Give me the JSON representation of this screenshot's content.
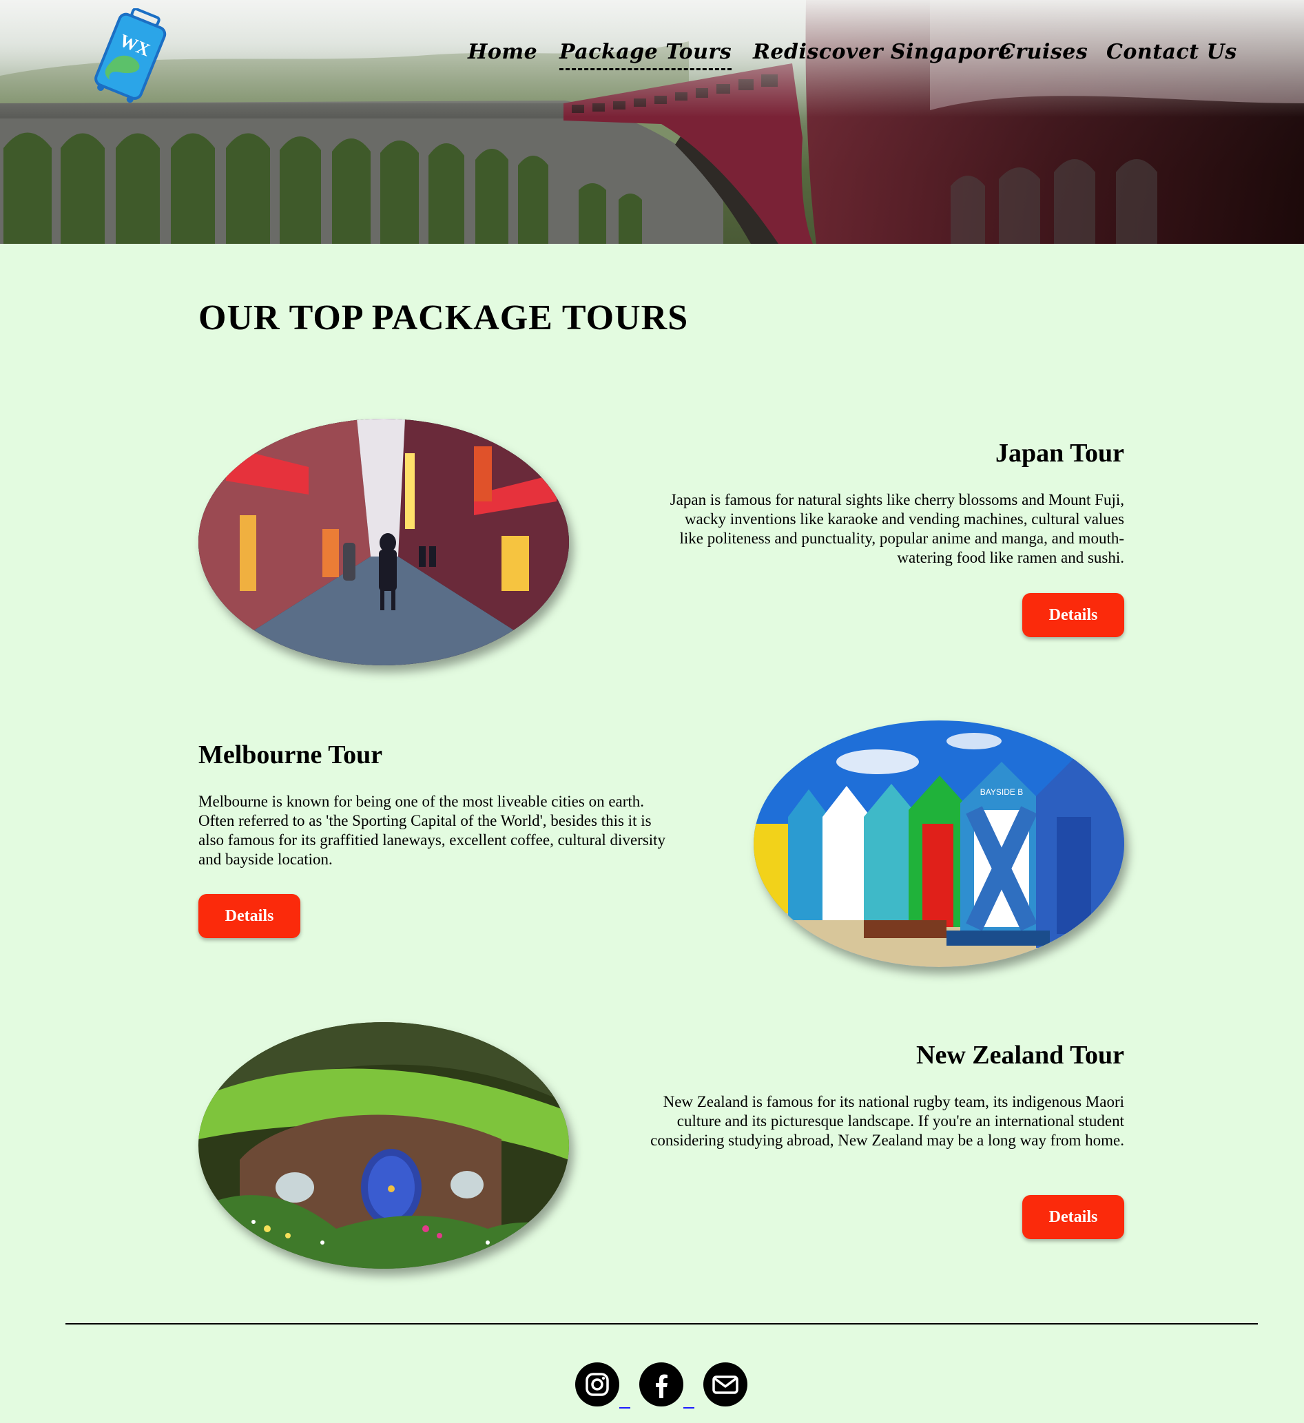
{
  "brand": {
    "logo_text": "WX",
    "logo_name": "luggage-logo"
  },
  "nav": {
    "items": [
      {
        "label": "Home",
        "active": false
      },
      {
        "label": "Package Tours",
        "active": true
      },
      {
        "label": "Rediscover Singapore",
        "active": false
      },
      {
        "label": "Cruises",
        "active": false
      },
      {
        "label": "Contact Us",
        "active": false
      }
    ]
  },
  "main": {
    "section_title": "OUR TOP PACKAGE TOURS",
    "tours": [
      {
        "title": "Japan Tour",
        "description": "Japan is famous for natural sights like cherry blossoms and Mount Fuji, wacky inventions like karaoke and vending machines, cultural values like politeness and punctuality, popular anime and manga, and mouth-watering food like ramen and sushi.",
        "button_label": "Details",
        "image": "tokyo-alley-photo"
      },
      {
        "title": "Melbourne Tour",
        "description": "Melbourne is known for being one of the most liveable cities on earth. Often referred to as 'the Sporting Capital of the World', besides this it is also famous for its graffitied laneways, excellent coffee, cultural diversity and bayside location.",
        "button_label": "Details",
        "image": "beach-huts-photo",
        "hut_sign": "BAYSIDE B"
      },
      {
        "title": "New Zealand Tour",
        "description": "New Zealand is famous for its national rugby team, its indigenous Maori culture and its picturesque landscape. If you're an international student considering studying abroad, New Zealand may be a long way from home.",
        "button_label": "Details",
        "image": "hobbit-hole-photo"
      }
    ]
  },
  "footer": {
    "social": [
      {
        "icon": "instagram-icon"
      },
      {
        "icon": "facebook-icon"
      },
      {
        "icon": "email-icon"
      }
    ]
  },
  "colors": {
    "background": "#e3fbe0",
    "button": "#fb2a0b",
    "button_text": "#ffffff"
  }
}
